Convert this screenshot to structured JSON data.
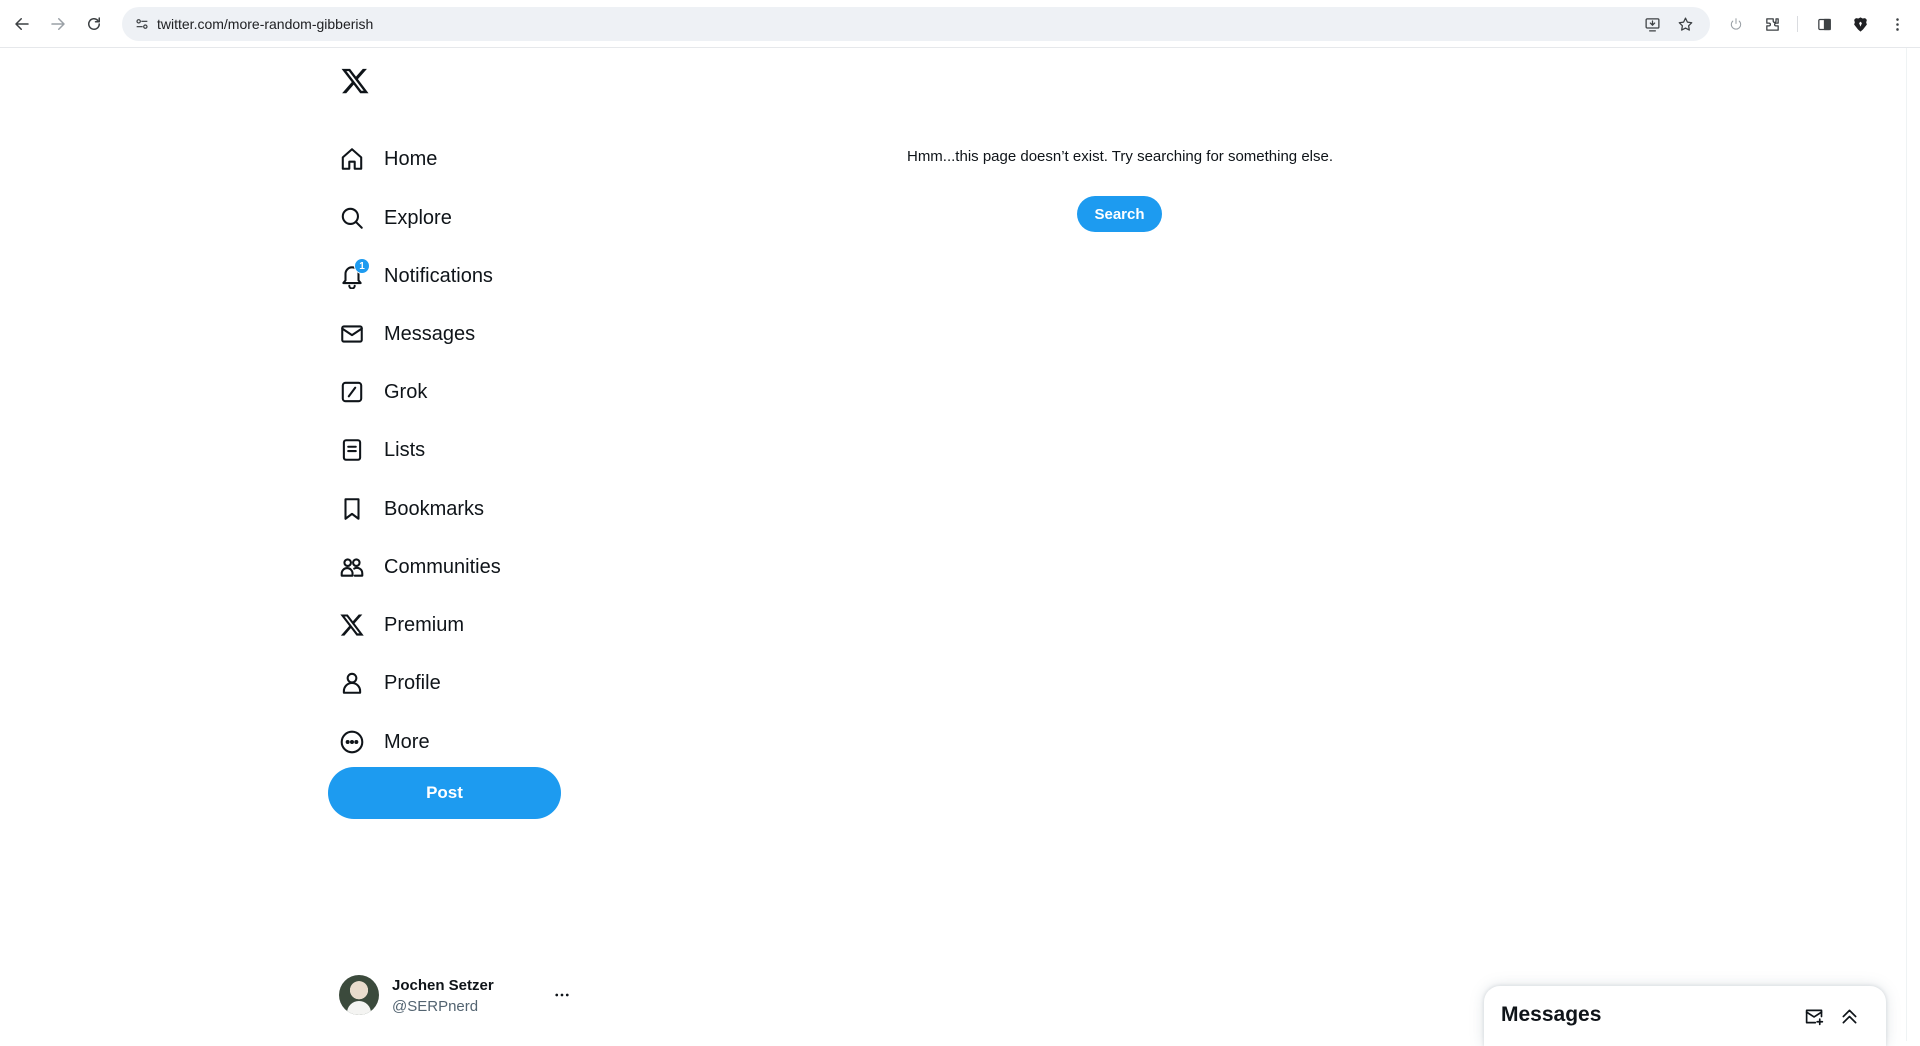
{
  "browser": {
    "url": "twitter.com/more-random-gibberish",
    "icons": [
      "back-icon",
      "forward-icon",
      "reload-icon",
      "site-info-icon",
      "install-icon",
      "star-icon",
      "power-icon",
      "extensions-icon",
      "side-panel-icon",
      "brave-icon",
      "menu-icon"
    ]
  },
  "sidebar": {
    "items": [
      {
        "label": "Home",
        "icon": "home-icon"
      },
      {
        "label": "Explore",
        "icon": "search-icon"
      },
      {
        "label": "Notifications",
        "icon": "bell-icon",
        "badge": "1"
      },
      {
        "label": "Messages",
        "icon": "envelope-icon"
      },
      {
        "label": "Grok",
        "icon": "grok-icon"
      },
      {
        "label": "Lists",
        "icon": "list-icon"
      },
      {
        "label": "Bookmarks",
        "icon": "bookmark-icon"
      },
      {
        "label": "Communities",
        "icon": "people-icon"
      },
      {
        "label": "Premium",
        "icon": "x-logo-icon"
      },
      {
        "label": "Profile",
        "icon": "person-icon"
      },
      {
        "label": "More",
        "icon": "more-circle-icon"
      }
    ],
    "post_label": "Post"
  },
  "account": {
    "name": "Jochen Setzer",
    "handle": "@SERPnerd"
  },
  "main": {
    "message": "Hmm...this page doesn’t exist. Try searching for something else.",
    "search_label": "Search"
  },
  "messages_drawer": {
    "title": "Messages"
  },
  "colors": {
    "accent": "#1d9bf0",
    "text": "#0f1419",
    "secondary_text": "#536471"
  }
}
